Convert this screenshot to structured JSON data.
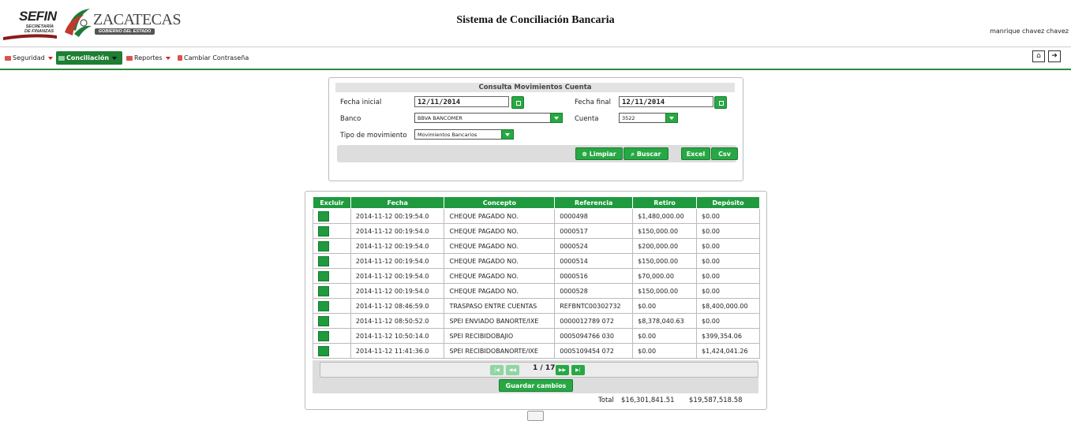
{
  "header": {
    "title": "Sistema de Conciliación Bancaria",
    "username": "manrique chavez chavez",
    "logo_sefin": "SEFIN",
    "logo_sefin_sub": "SECRETARÍA DE FINANZAS",
    "logo_zac": "ZACATECAS",
    "logo_zac_sub": "GOBIERNO DEL ESTADO"
  },
  "menu": {
    "items": [
      {
        "label": "Seguridad"
      },
      {
        "label": "Conciliación"
      },
      {
        "label": "Reportes"
      },
      {
        "label": "Cambiar Contraseña"
      }
    ],
    "icons": [
      "home-icon",
      "logout-icon"
    ]
  },
  "search": {
    "title": "Consulta Movimientos Cuenta",
    "fecha_inicial_label": "Fecha inicial",
    "fecha_inicial": "12/11/2014",
    "fecha_final_label": "Fecha final",
    "fecha_final": "12/11/2014",
    "banco_label": "Banco",
    "banco": "BBVA BANCOMER",
    "cuenta_label": "Cuenta",
    "cuenta": "3522",
    "tipo_label": "Tipo de movimiento",
    "tipo": "Movimientos Bancarios",
    "btn_limpiar": "Limpiar",
    "btn_buscar": "Buscar",
    "btn_excel": "Excel",
    "btn_csv": "Csv"
  },
  "table": {
    "columns": [
      "Excluir",
      "Fecha",
      "Concepto",
      "Referencia",
      "Retiro",
      "Depósito"
    ],
    "rows": [
      {
        "fecha": "2014-11-12 00:19:54.0",
        "concepto": "CHEQUE PAGADO NO.",
        "referencia": "0000498",
        "retiro": "$1,480,000.00",
        "deposito": "$0.00"
      },
      {
        "fecha": "2014-11-12 00:19:54.0",
        "concepto": "CHEQUE PAGADO NO.",
        "referencia": "0000517",
        "retiro": "$150,000.00",
        "deposito": "$0.00"
      },
      {
        "fecha": "2014-11-12 00:19:54.0",
        "concepto": "CHEQUE PAGADO NO.",
        "referencia": "0000524",
        "retiro": "$200,000.00",
        "deposito": "$0.00"
      },
      {
        "fecha": "2014-11-12 00:19:54.0",
        "concepto": "CHEQUE PAGADO NO.",
        "referencia": "0000514",
        "retiro": "$150,000.00",
        "deposito": "$0.00"
      },
      {
        "fecha": "2014-11-12 00:19:54.0",
        "concepto": "CHEQUE PAGADO NO.",
        "referencia": "0000516",
        "retiro": "$70,000.00",
        "deposito": "$0.00"
      },
      {
        "fecha": "2014-11-12 00:19:54.0",
        "concepto": "CHEQUE PAGADO NO.",
        "referencia": "0000528",
        "retiro": "$150,000.00",
        "deposito": "$0.00"
      },
      {
        "fecha": "2014-11-12 08:46:59.0",
        "concepto": "TRASPASO ENTRE CUENTAS",
        "referencia": "REFBNTC00302732",
        "retiro": "$0.00",
        "deposito": "$8,400,000.00"
      },
      {
        "fecha": "2014-11-12 08:50:52.0",
        "concepto": "SPEI ENVIADO BANORTE/IXE",
        "referencia": "0000012789 072",
        "retiro": "$8,378,040.63",
        "deposito": "$0.00"
      },
      {
        "fecha": "2014-11-12 10:50:14.0",
        "concepto": "SPEI RECIBIDOBAJIO",
        "referencia": "0005094766 030",
        "retiro": "$0.00",
        "deposito": "$399,354.06"
      },
      {
        "fecha": "2014-11-12 11:41:36.0",
        "concepto": "SPEI RECIBIDOBANORTE/IXE",
        "referencia": "0005109454 072",
        "retiro": "$0.00",
        "deposito": "$1,424,041.26"
      }
    ],
    "pager": "1 / 17",
    "save_label": "Guardar cambios",
    "total_label": "Total",
    "total_retiro": "$16,301,841.51",
    "total_deposito": "$19,587,518.58"
  }
}
